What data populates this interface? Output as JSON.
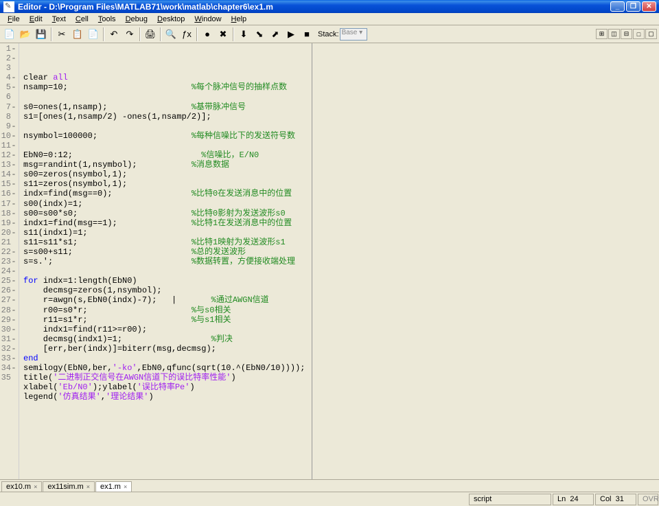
{
  "title": "Editor - D:\\Program Files\\MATLAB71\\work\\matlab\\chapter6\\ex1.m",
  "menus": [
    "File",
    "Edit",
    "Text",
    "Cell",
    "Tools",
    "Debug",
    "Desktop",
    "Window",
    "Help"
  ],
  "stack_label": "Stack:",
  "stack_value": "Base",
  "lines": [
    {
      "n": 1,
      "d": true,
      "seg": [
        {
          "t": "clear ",
          "c": ""
        },
        {
          "t": "all",
          "c": "st"
        }
      ]
    },
    {
      "n": 2,
      "d": true,
      "seg": [
        {
          "t": "nsamp=10;                         ",
          "c": ""
        },
        {
          "t": "%每个脉冲信号的抽样点数",
          "c": "cm"
        }
      ]
    },
    {
      "n": 3,
      "d": false,
      "seg": []
    },
    {
      "n": 4,
      "d": true,
      "seg": [
        {
          "t": "s0=ones(1,nsamp);                 ",
          "c": ""
        },
        {
          "t": "%基带脉冲信号",
          "c": "cm"
        }
      ]
    },
    {
      "n": 5,
      "d": true,
      "seg": [
        {
          "t": "s1=[ones(1,nsamp/2) -ones(1,nsamp/2)];",
          "c": ""
        }
      ]
    },
    {
      "n": 6,
      "d": false,
      "seg": []
    },
    {
      "n": 7,
      "d": true,
      "seg": [
        {
          "t": "nsymbol=100000;                   ",
          "c": ""
        },
        {
          "t": "%每种信噪比下的发送符号数",
          "c": "cm"
        }
      ]
    },
    {
      "n": 8,
      "d": false,
      "seg": []
    },
    {
      "n": 9,
      "d": true,
      "seg": [
        {
          "t": "EbN0=0:12;                          ",
          "c": ""
        },
        {
          "t": "%信噪比，E/N0",
          "c": "cm"
        }
      ]
    },
    {
      "n": 10,
      "d": true,
      "seg": [
        {
          "t": "msg=randint(1,nsymbol);           ",
          "c": ""
        },
        {
          "t": "%消息数据",
          "c": "cm"
        }
      ]
    },
    {
      "n": 11,
      "d": true,
      "seg": [
        {
          "t": "s00=zeros(nsymbol,1);",
          "c": ""
        }
      ]
    },
    {
      "n": 12,
      "d": true,
      "seg": [
        {
          "t": "s11=zeros(nsymbol,1);",
          "c": ""
        }
      ]
    },
    {
      "n": 13,
      "d": true,
      "seg": [
        {
          "t": "indx=find(msg==0);                ",
          "c": ""
        },
        {
          "t": "%比特0在发送消息中的位置",
          "c": "cm"
        }
      ]
    },
    {
      "n": 14,
      "d": true,
      "seg": [
        {
          "t": "s00(indx)=1;",
          "c": ""
        }
      ]
    },
    {
      "n": 15,
      "d": true,
      "seg": [
        {
          "t": "s00=s00*s0;                       ",
          "c": ""
        },
        {
          "t": "%比特0影射为发送波形s0",
          "c": "cm"
        }
      ]
    },
    {
      "n": 16,
      "d": true,
      "seg": [
        {
          "t": "indx1=find(msg==1);               ",
          "c": ""
        },
        {
          "t": "%比特1在发送消息中的位置",
          "c": "cm"
        }
      ]
    },
    {
      "n": 17,
      "d": true,
      "seg": [
        {
          "t": "s11(indx1)=1;",
          "c": ""
        }
      ]
    },
    {
      "n": 18,
      "d": true,
      "seg": [
        {
          "t": "s11=s11*s1;                       ",
          "c": ""
        },
        {
          "t": "%比特1映射为发送波形s1",
          "c": "cm"
        }
      ]
    },
    {
      "n": 19,
      "d": true,
      "seg": [
        {
          "t": "s=s00+s11;                        ",
          "c": ""
        },
        {
          "t": "%总的发送波形",
          "c": "cm"
        }
      ]
    },
    {
      "n": 20,
      "d": true,
      "seg": [
        {
          "t": "s=s.';                            ",
          "c": ""
        },
        {
          "t": "%数据转置，方便接收端处理",
          "c": "cm"
        }
      ]
    },
    {
      "n": 21,
      "d": false,
      "seg": []
    },
    {
      "n": 22,
      "d": true,
      "seg": [
        {
          "t": "for ",
          "c": "kw"
        },
        {
          "t": "indx=1:length(EbN0)",
          "c": ""
        }
      ]
    },
    {
      "n": 23,
      "d": true,
      "seg": [
        {
          "t": "    decmsg=zeros(1,nsymbol);",
          "c": ""
        }
      ]
    },
    {
      "n": 24,
      "d": true,
      "seg": [
        {
          "t": "    r=awgn(s,EbN0(indx)-7);   |       ",
          "c": ""
        },
        {
          "t": "%通过AWGN信道",
          "c": "cm"
        }
      ],
      "cursor": true
    },
    {
      "n": 25,
      "d": true,
      "seg": [
        {
          "t": "    r00=s0*r;                     ",
          "c": ""
        },
        {
          "t": "%与s0相关",
          "c": "cm"
        }
      ]
    },
    {
      "n": 26,
      "d": true,
      "seg": [
        {
          "t": "    r11=s1*r;                     ",
          "c": ""
        },
        {
          "t": "%与s1相关",
          "c": "cm"
        }
      ]
    },
    {
      "n": 27,
      "d": true,
      "seg": [
        {
          "t": "    indx1=find(r11>=r00);",
          "c": ""
        }
      ]
    },
    {
      "n": 28,
      "d": true,
      "seg": [
        {
          "t": "    decmsg(indx1)=1;                  ",
          "c": ""
        },
        {
          "t": "%判决",
          "c": "cm"
        }
      ]
    },
    {
      "n": 29,
      "d": true,
      "seg": [
        {
          "t": "    [err,ber(indx)]=biterr(msg,decmsg);",
          "c": ""
        }
      ]
    },
    {
      "n": 30,
      "d": true,
      "seg": [
        {
          "t": "end",
          "c": "kw"
        }
      ]
    },
    {
      "n": 31,
      "d": true,
      "seg": [
        {
          "t": "semilogy(EbN0,ber,",
          "c": ""
        },
        {
          "t": "'-ko'",
          "c": "st"
        },
        {
          "t": ",EbN0,qfunc(sqrt(10.^(EbN0/10))));",
          "c": ""
        }
      ]
    },
    {
      "n": 32,
      "d": true,
      "seg": [
        {
          "t": "title(",
          "c": ""
        },
        {
          "t": "'二进制正交信号在AWGN信道下的误比特率性能'",
          "c": "st"
        },
        {
          "t": ")",
          "c": ""
        }
      ]
    },
    {
      "n": 33,
      "d": true,
      "seg": [
        {
          "t": "xlabel(",
          "c": ""
        },
        {
          "t": "'Eb/N0'",
          "c": "st"
        },
        {
          "t": ");ylabel(",
          "c": ""
        },
        {
          "t": "'误比特率Pe'",
          "c": "st"
        },
        {
          "t": ")",
          "c": ""
        }
      ]
    },
    {
      "n": 34,
      "d": true,
      "seg": [
        {
          "t": "legend(",
          "c": ""
        },
        {
          "t": "'仿真结果'",
          "c": "st"
        },
        {
          "t": ",",
          "c": ""
        },
        {
          "t": "'理论结果'",
          "c": "st"
        },
        {
          "t": ")",
          "c": ""
        }
      ]
    },
    {
      "n": 35,
      "d": false,
      "seg": []
    }
  ],
  "tabs": [
    {
      "name": "ex10.m",
      "active": false
    },
    {
      "name": "ex11sim.m",
      "active": false
    },
    {
      "name": "ex1.m",
      "active": true
    }
  ],
  "status": {
    "mode": "script",
    "ln_label": "Ln",
    "ln": "24",
    "col_label": "Col",
    "col": "31",
    "ovr": "OVR"
  },
  "toolbar_icons": [
    {
      "name": "new-file-icon",
      "glyph": "📄"
    },
    {
      "name": "open-file-icon",
      "glyph": "📂"
    },
    {
      "name": "save-icon",
      "glyph": "💾"
    },
    {
      "name": "sep"
    },
    {
      "name": "cut-icon",
      "glyph": "✂"
    },
    {
      "name": "copy-icon",
      "glyph": "📋"
    },
    {
      "name": "paste-icon",
      "glyph": "📄"
    },
    {
      "name": "sep"
    },
    {
      "name": "undo-icon",
      "glyph": "↶"
    },
    {
      "name": "redo-icon",
      "glyph": "↷"
    },
    {
      "name": "sep"
    },
    {
      "name": "print-icon",
      "glyph": "🖨"
    },
    {
      "name": "sep"
    },
    {
      "name": "find-icon",
      "glyph": "🔍"
    },
    {
      "name": "function-icon",
      "glyph": "ƒx"
    },
    {
      "name": "sep"
    },
    {
      "name": "breakpoint-set-icon",
      "glyph": "●"
    },
    {
      "name": "breakpoint-clear-icon",
      "glyph": "✖"
    },
    {
      "name": "sep"
    },
    {
      "name": "step-icon",
      "glyph": "⬇"
    },
    {
      "name": "step-in-icon",
      "glyph": "⬊"
    },
    {
      "name": "step-out-icon",
      "glyph": "⬈"
    },
    {
      "name": "continue-icon",
      "glyph": "▶"
    },
    {
      "name": "stop-icon",
      "glyph": "■"
    }
  ],
  "right_icons": [
    {
      "name": "tile-icon",
      "glyph": "⊞"
    },
    {
      "name": "split-h-icon",
      "glyph": "◫"
    },
    {
      "name": "split-v-icon",
      "glyph": "⊟"
    },
    {
      "name": "maximize-icon",
      "glyph": "□"
    },
    {
      "name": "float-icon",
      "glyph": "▢"
    }
  ]
}
